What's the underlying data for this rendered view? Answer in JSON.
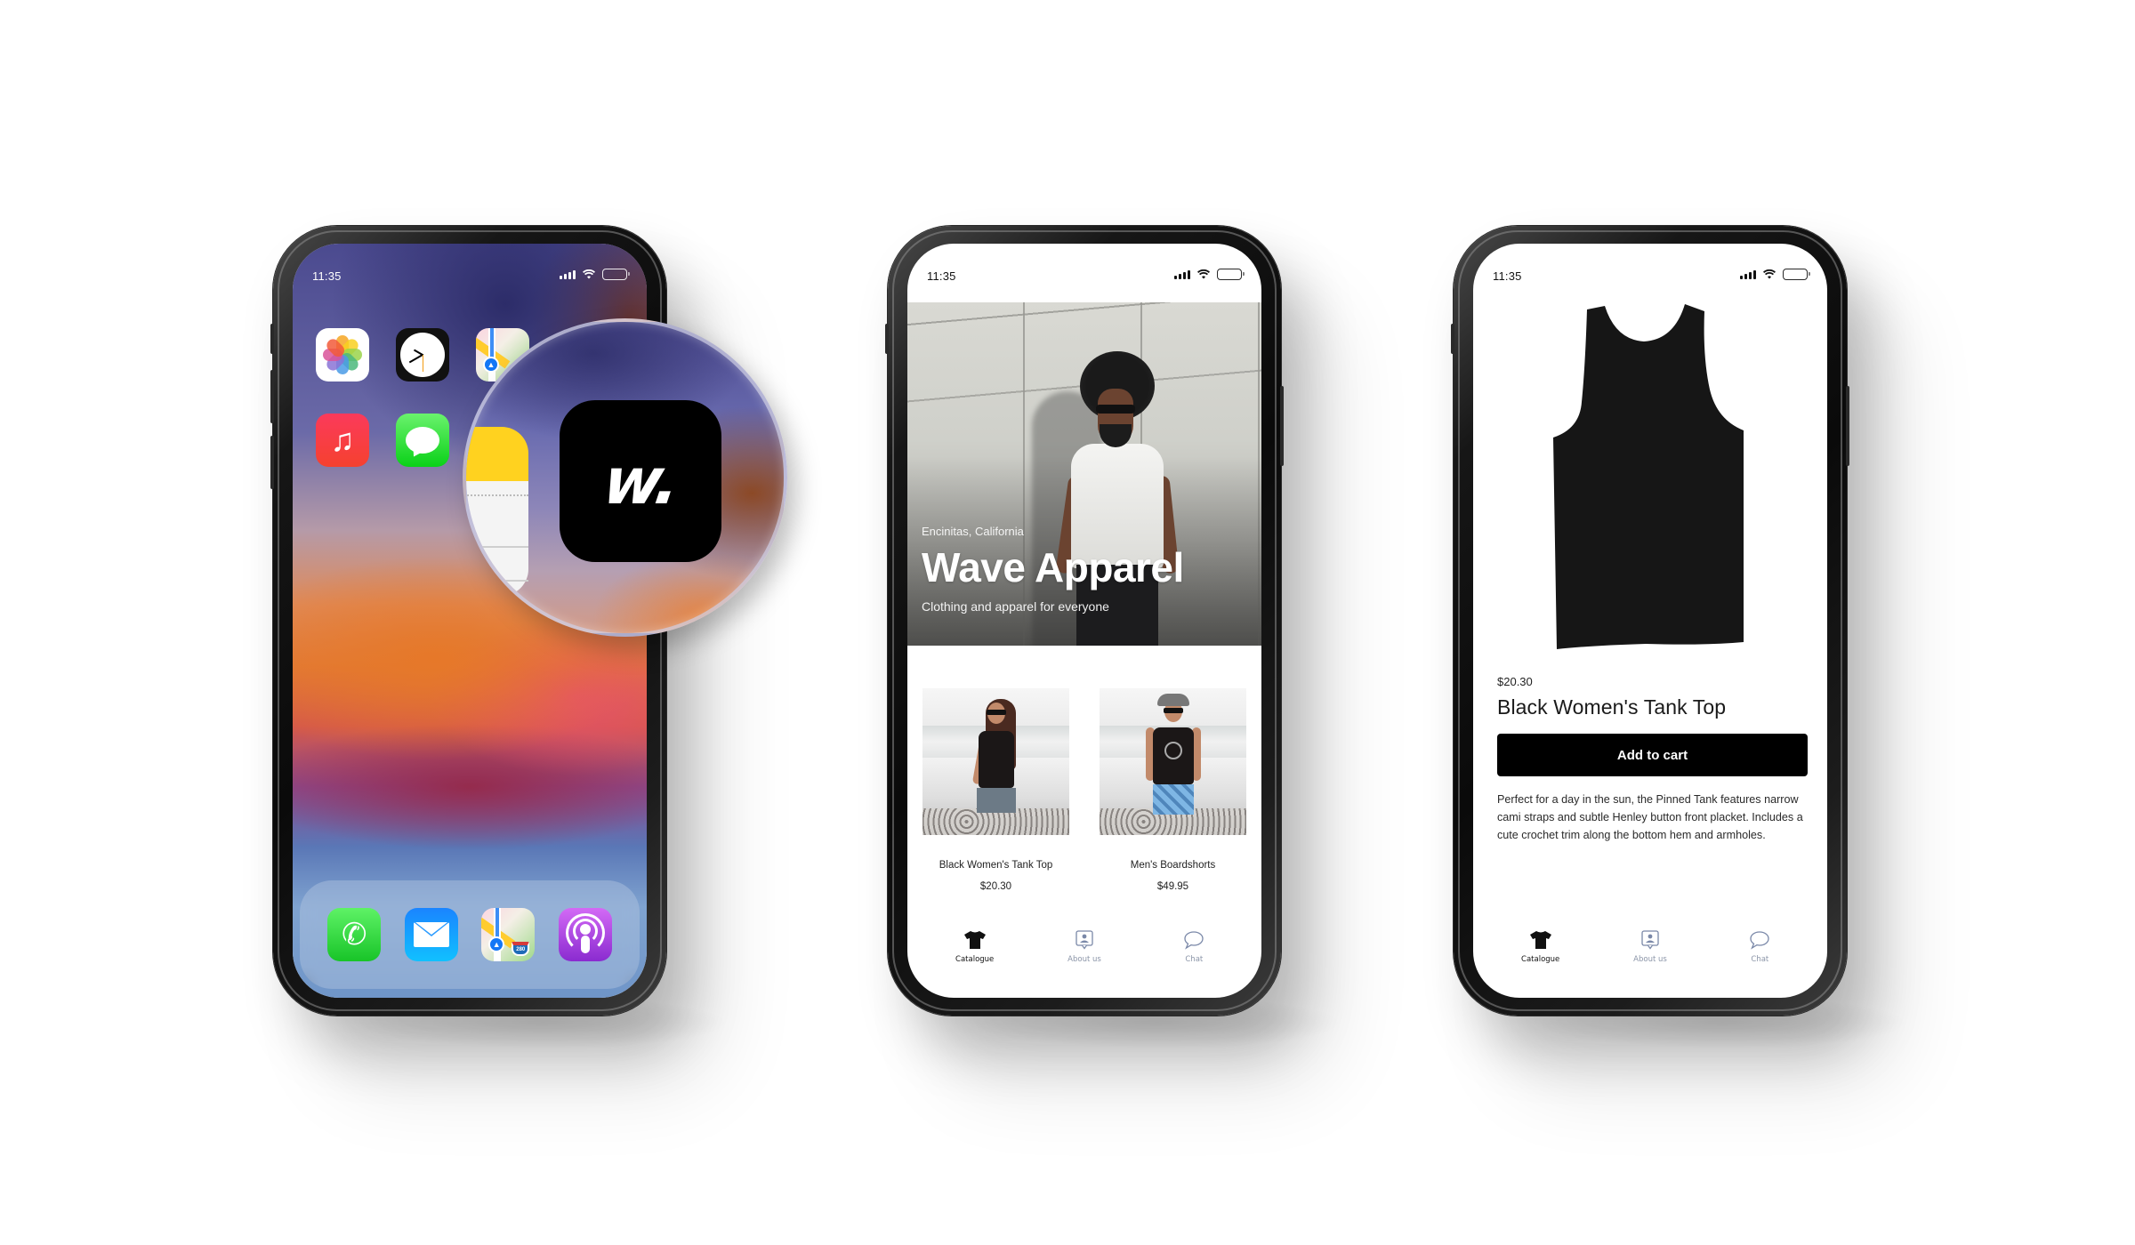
{
  "status_bar": {
    "time": "11:35",
    "icons": [
      "cellular-signal-icon",
      "wifi-icon",
      "battery-icon"
    ]
  },
  "phone1": {
    "screen": "home-screen",
    "apps_row1": [
      {
        "name": "Photos",
        "icon": "photos-icon"
      },
      {
        "name": "Clock",
        "icon": "clock-icon"
      },
      {
        "name": "Maps",
        "icon": "maps-icon"
      }
    ],
    "apps_row2": [
      {
        "name": "Music",
        "icon": "music-icon"
      },
      {
        "name": "Messages",
        "icon": "messages-icon"
      },
      {
        "name": "Notes",
        "icon": "notes-icon"
      }
    ],
    "dock": [
      {
        "name": "Phone",
        "icon": "phone-icon"
      },
      {
        "name": "Mail",
        "icon": "mail-icon"
      },
      {
        "name": "Maps",
        "icon": "maps-icon",
        "badge": "280"
      },
      {
        "name": "Podcasts",
        "icon": "podcasts-icon"
      }
    ],
    "magnified_app": {
      "name": "Wave Apparel",
      "logo_text": "w.",
      "color": "#000000"
    }
  },
  "storefront": {
    "hero": {
      "location": "Encinitas, California",
      "title": "Wave Apparel",
      "tagline": "Clothing and apparel for everyone"
    },
    "products": [
      {
        "name": "Black Women's Tank Top",
        "price": "$20.30"
      },
      {
        "name": "Men's Boardshorts",
        "price": "$49.95"
      }
    ]
  },
  "tabbar": {
    "items": [
      {
        "label": "Catalogue",
        "icon": "tshirt-icon",
        "active": true
      },
      {
        "label": "About us",
        "icon": "profile-card-icon",
        "active": false
      },
      {
        "label": "Chat",
        "icon": "chat-bubble-icon",
        "active": false
      }
    ],
    "active_color": "#111111",
    "inactive_color": "#8b95a8"
  },
  "product_detail": {
    "price": "$20.30",
    "title": "Black Women's Tank Top",
    "add_to_cart_label": "Add to cart",
    "description": "Perfect for a day in the sun, the Pinned Tank features narrow cami straps and subtle Henley button front placket. Includes a cute crochet trim along the bottom hem and armholes."
  }
}
